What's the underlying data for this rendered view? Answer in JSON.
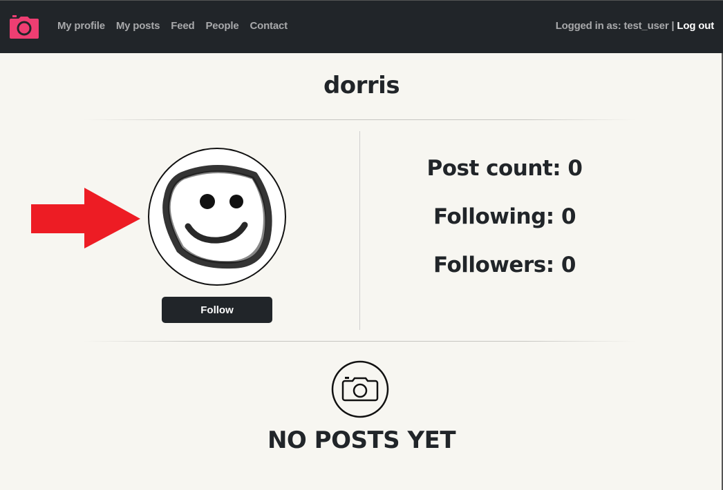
{
  "navbar": {
    "links": [
      "My profile",
      "My posts",
      "Feed",
      "People",
      "Contact"
    ],
    "logged_in_text": "Logged in as: test_user |",
    "logout_label": "Log out"
  },
  "profile": {
    "username": "dorris",
    "follow_label": "Follow",
    "stats": {
      "post_count": "Post count: 0",
      "following": "Following: 0",
      "followers": "Followers: 0"
    }
  },
  "posts": {
    "empty_text": "NO POSTS YET"
  },
  "icons": {
    "brand": "camera-icon",
    "empty": "camera-icon",
    "annotation": "red-arrow"
  },
  "colors": {
    "navbar": "#212529",
    "brand_accent": "#ee3e72",
    "background": "#f7f6f1",
    "annotation_arrow": "#ed1c24"
  }
}
